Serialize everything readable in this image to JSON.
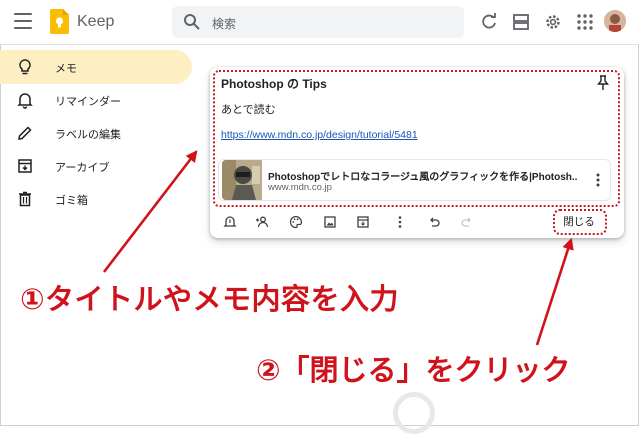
{
  "header": {
    "app_title": "Keep",
    "search_placeholder": "検索",
    "icons": [
      "menu-icon",
      "keep-logo",
      "search-icon",
      "refresh-icon",
      "list-view-icon",
      "settings-icon",
      "apps-icon",
      "account-avatar"
    ]
  },
  "sidebar": {
    "items": [
      {
        "label": "メモ",
        "icon": "lightbulb-icon",
        "active": true
      },
      {
        "label": "リマインダー",
        "icon": "bell-icon"
      },
      {
        "label": "ラベルの編集",
        "icon": "pencil-icon"
      },
      {
        "label": "アーカイブ",
        "icon": "archive-icon"
      },
      {
        "label": "ゴミ箱",
        "icon": "trash-icon"
      }
    ]
  },
  "note": {
    "title": "Photoshop の Tips",
    "body": "あとで読む",
    "link": "https://www.mdn.co.jp/design/tutorial/5481",
    "preview": {
      "title": "Photoshopでレトロなコラージュ風のグラフィックを作る|Photosh...",
      "domain": "www.mdn.co.jp"
    },
    "toolbar_icons": [
      "remind-icon",
      "collaborator-icon",
      "palette-icon",
      "image-icon",
      "archive-icon",
      "more-icon",
      "undo-icon",
      "redo-icon"
    ],
    "close_label": "閉じる"
  },
  "annotations": {
    "step1": "①タイトルやメモ内容を入力",
    "step2": "②「閉じる」をクリック"
  },
  "colors": {
    "accent_red": "#d0121b",
    "active_bg": "#feefc3",
    "link": "#1a56b4"
  }
}
